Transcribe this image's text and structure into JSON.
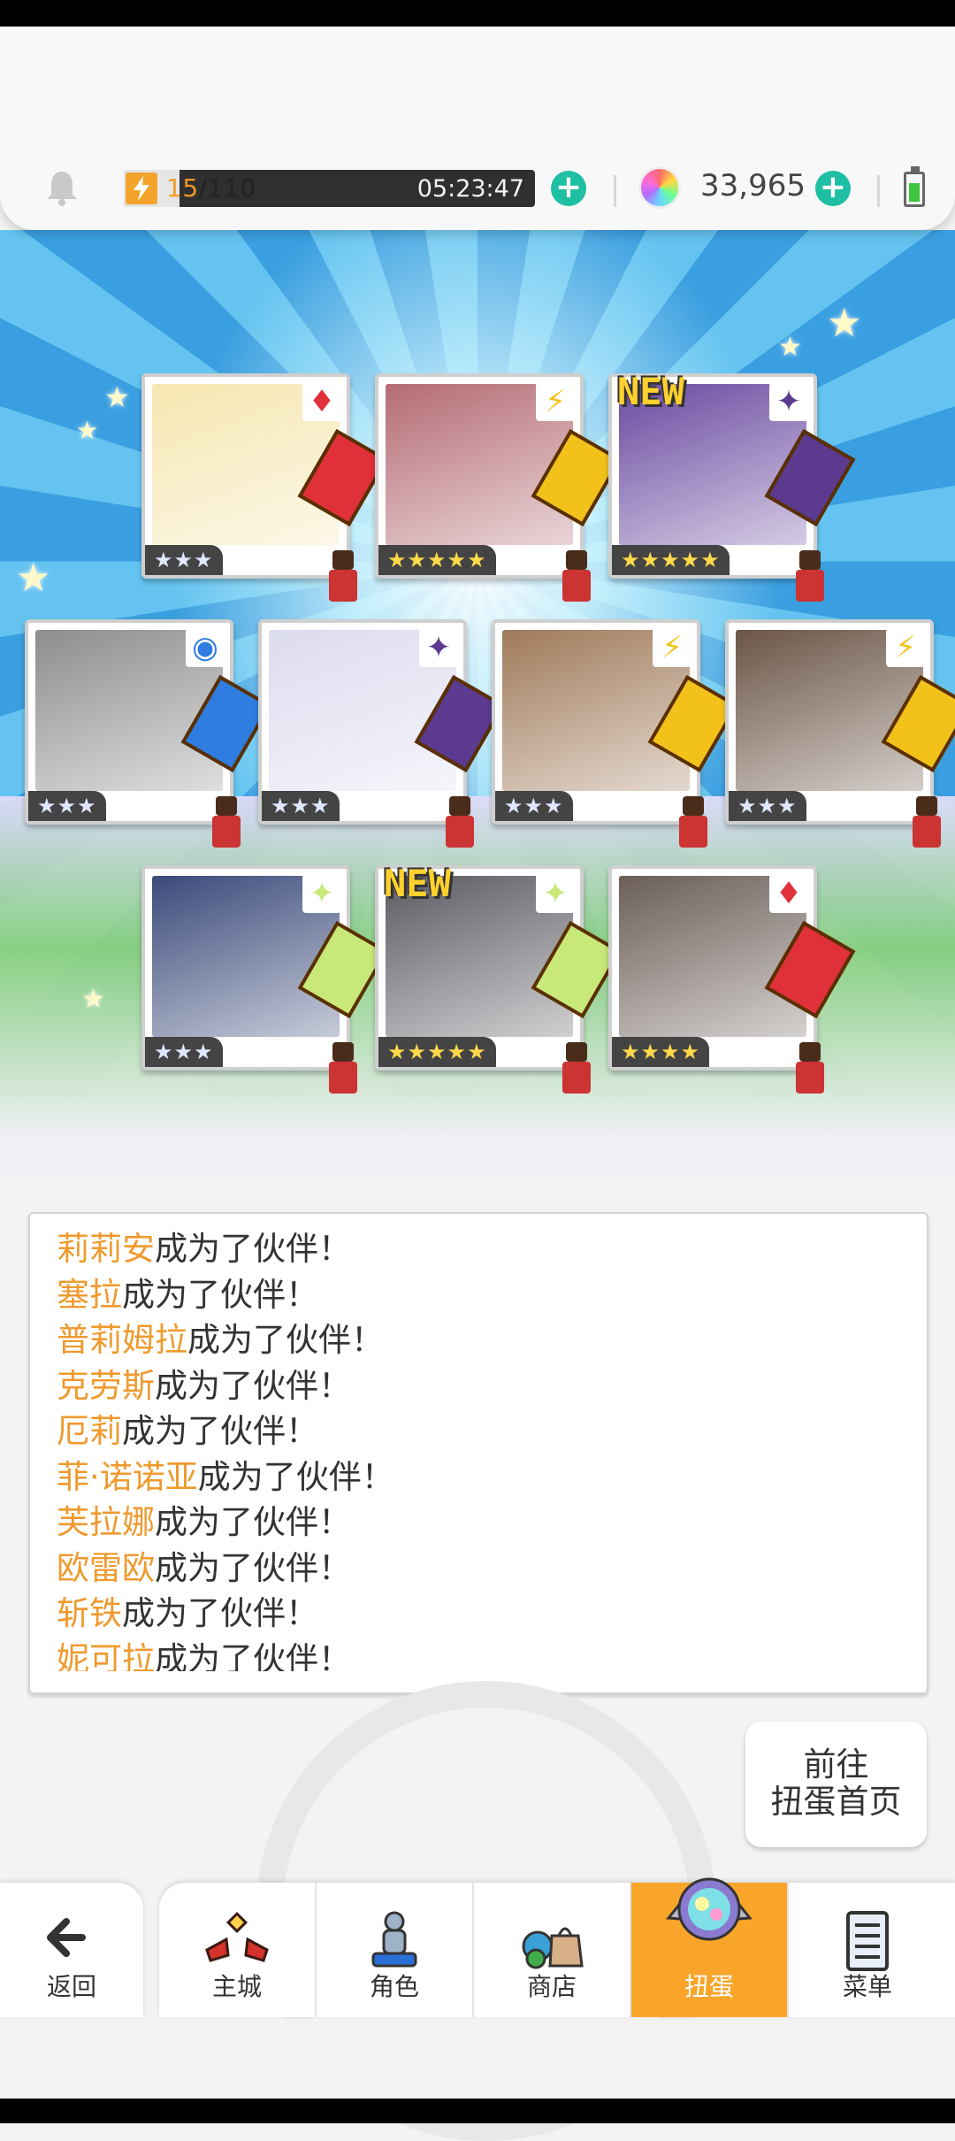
{
  "header": {
    "stamina_current": "15",
    "stamina_max": "/110",
    "stamina_fraction": 0.136,
    "stamina_timer": "05:23:47",
    "gems": "33,965"
  },
  "cards": [
    {
      "rarity": "★★★",
      "attr": "♦",
      "attr_color": "#e0303a",
      "new": "",
      "portrait": "#f6e6b0"
    },
    {
      "rarity": "★★★★★",
      "attr": "⚡",
      "attr_color": "#f3c21a",
      "new": "",
      "portrait": "#b46b74"
    },
    {
      "rarity": "★★★★★",
      "attr": "✦",
      "attr_color": "#5b3a8f",
      "new": "NEW",
      "portrait": "#6a4aa0"
    },
    {
      "rarity": "★★★",
      "attr": "◉",
      "attr_color": "#2f7de0",
      "new": "",
      "portrait": "#8d8d8d"
    },
    {
      "rarity": "★★★",
      "attr": "✦",
      "attr_color": "#5b3a8f",
      "new": "",
      "portrait": "#dcdcef"
    },
    {
      "rarity": "★★★",
      "attr": "⚡",
      "attr_color": "#f3c21a",
      "new": "",
      "portrait": "#a07a5a"
    },
    {
      "rarity": "★★★",
      "attr": "⚡",
      "attr_color": "#f3c21a",
      "new": "",
      "portrait": "#6b5546"
    },
    {
      "rarity": "★★★",
      "attr": "✦",
      "attr_color": "#c9e87a",
      "new": "",
      "portrait": "#3a4a7a"
    },
    {
      "rarity": "★★★★★",
      "attr": "✦",
      "attr_color": "#c9e87a",
      "new": "NEW",
      "portrait": "#5a5a62"
    },
    {
      "rarity": "★★★★",
      "attr": "♦",
      "attr_color": "#e0303a",
      "new": "",
      "portrait": "#6b5e58"
    }
  ],
  "log": {
    "suffix": "成为了伙伴！",
    "names": [
      "莉莉安",
      "塞拉",
      "普莉姆拉",
      "克劳斯",
      "厄莉",
      "菲·诺诺亚",
      "芙拉娜",
      "欧雷欧",
      "斩铁",
      "妮可拉"
    ]
  },
  "goto_button": {
    "line1": "前往",
    "line2": "扭蛋首页"
  },
  "nav": {
    "back": "返回",
    "tabs": [
      "主城",
      "角色",
      "商店",
      "扭蛋",
      "菜单"
    ],
    "active": "扭蛋"
  }
}
